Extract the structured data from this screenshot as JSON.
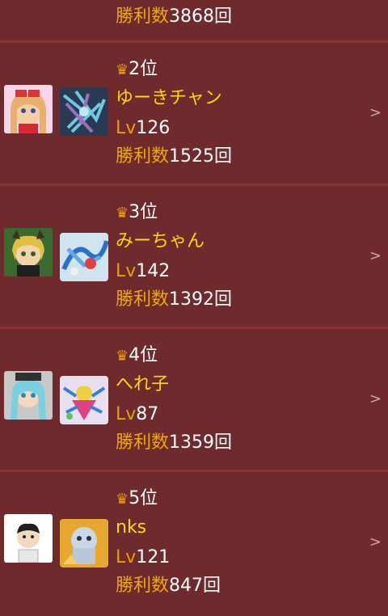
{
  "top": {
    "wins_label": "勝利数",
    "wins_value": "3868回"
  },
  "entries": [
    {
      "rank": "2位",
      "name": "ゆーきチャン",
      "lv_label": "Lv",
      "lv_value": "126",
      "wins_label": "勝利数",
      "wins_value": "1525回",
      "chevron": ">"
    },
    {
      "rank": "3位",
      "name": "みーちゃん",
      "lv_label": "Lv",
      "lv_value": "142",
      "wins_label": "勝利数",
      "wins_value": "1392回",
      "chevron": ">"
    },
    {
      "rank": "4位",
      "name": "へれ子",
      "lv_label": "Lv",
      "lv_value": "87",
      "wins_label": "勝利数",
      "wins_value": "1359回",
      "chevron": ">"
    },
    {
      "rank": "5位",
      "name": "nks",
      "lv_label": "Lv",
      "lv_value": "121",
      "wins_label": "勝利数",
      "wins_value": "847回",
      "chevron": ">"
    }
  ],
  "icons": {
    "crown": "crown-icon",
    "chevron": "chevron-right-icon"
  }
}
